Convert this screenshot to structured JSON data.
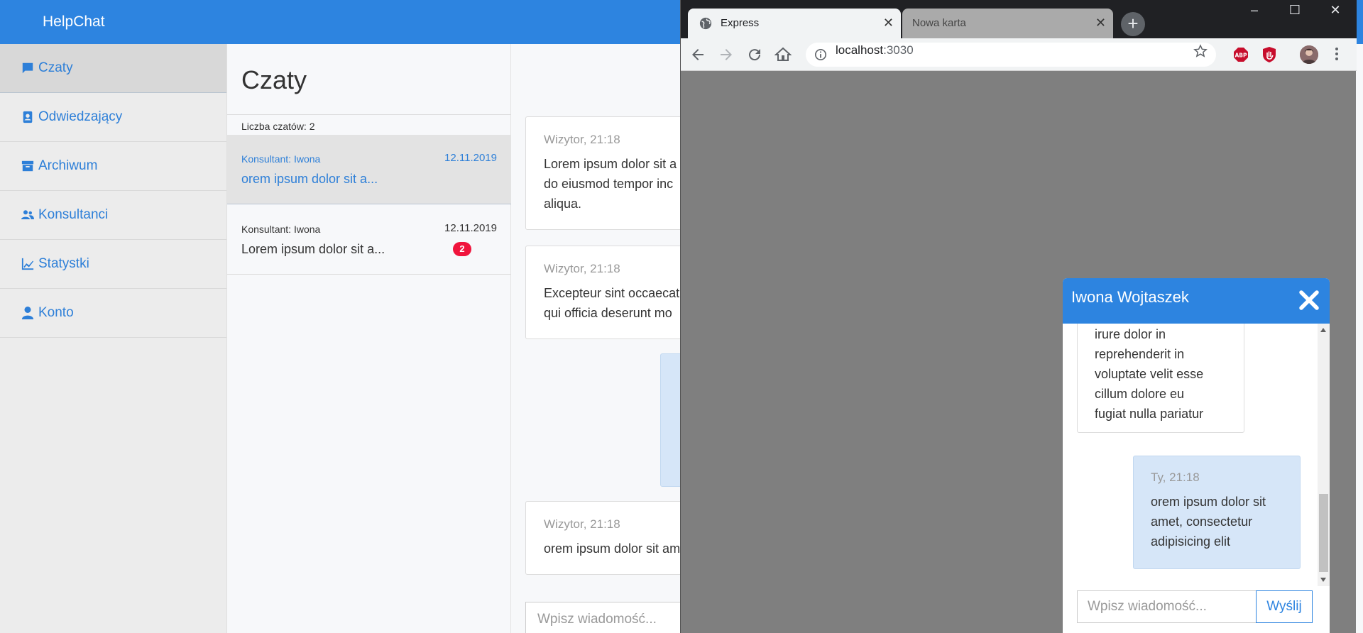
{
  "app": {
    "brand": "HelpChat",
    "nav": [
      {
        "label": "Czaty",
        "icon": "chat-bubble-icon"
      },
      {
        "label": "Odwiedzający",
        "icon": "contact-card-icon"
      },
      {
        "label": "Archiwum",
        "icon": "archive-box-icon"
      },
      {
        "label": "Konsultanci",
        "icon": "users-icon"
      },
      {
        "label": "Statystki",
        "icon": "chart-line-icon"
      },
      {
        "label": "Konto",
        "icon": "user-icon"
      }
    ],
    "chat_list": {
      "title": "Czaty",
      "count_label": "Liczba czatów: 2",
      "items": [
        {
          "consultant": "Konsultant: Iwona",
          "date": "12.11.2019",
          "preview": "orem ipsum dolor sit a...",
          "badge": ""
        },
        {
          "consultant": "Konsultant: Iwona",
          "date": "12.11.2019",
          "preview": "Lorem ipsum dolor sit a...",
          "badge": "2"
        }
      ]
    },
    "conversation": {
      "messages": [
        {
          "meta": "Wizytor, 21:18",
          "lines": [
            "Lorem ipsum dolor sit a",
            "do eiusmod tempor inc",
            "aliqua."
          ]
        },
        {
          "meta": "Wizytor, 21:18",
          "lines": [
            "Excepteur sint occaecat",
            "qui officia deserunt mo"
          ]
        },
        {
          "meta": "Wizytor, 21:18",
          "lines": [
            "orem ipsum dolor sit am"
          ]
        }
      ],
      "input_placeholder": "Wpisz wiadomość..."
    }
  },
  "browser": {
    "tabs": [
      {
        "title": "Express",
        "active": true
      },
      {
        "title": "Nowa karta",
        "active": false
      }
    ],
    "url_host": "localhost",
    "url_port": ":3030",
    "window_controls": {
      "minimize": "–",
      "maximize": "☐",
      "close": "✕"
    }
  },
  "widget": {
    "title": "Iwona Wojtaszek",
    "visitor_message_lines": [
      "irure dolor in",
      "reprehenderit in",
      "voluptate velit esse",
      "cillum dolore eu",
      "fugiat nulla pariatur"
    ],
    "own_message": {
      "meta": "Ty, 21:18",
      "lines": [
        "orem ipsum dolor sit",
        "amet, consectetur",
        "adipisicing elit"
      ]
    },
    "input_placeholder": "Wpisz wiadomość...",
    "send_label": "Wyślij"
  },
  "colors": {
    "brand_blue": "#2d84e0",
    "badge_red": "#f0143c",
    "own_bubble": "#d6e6f8"
  }
}
